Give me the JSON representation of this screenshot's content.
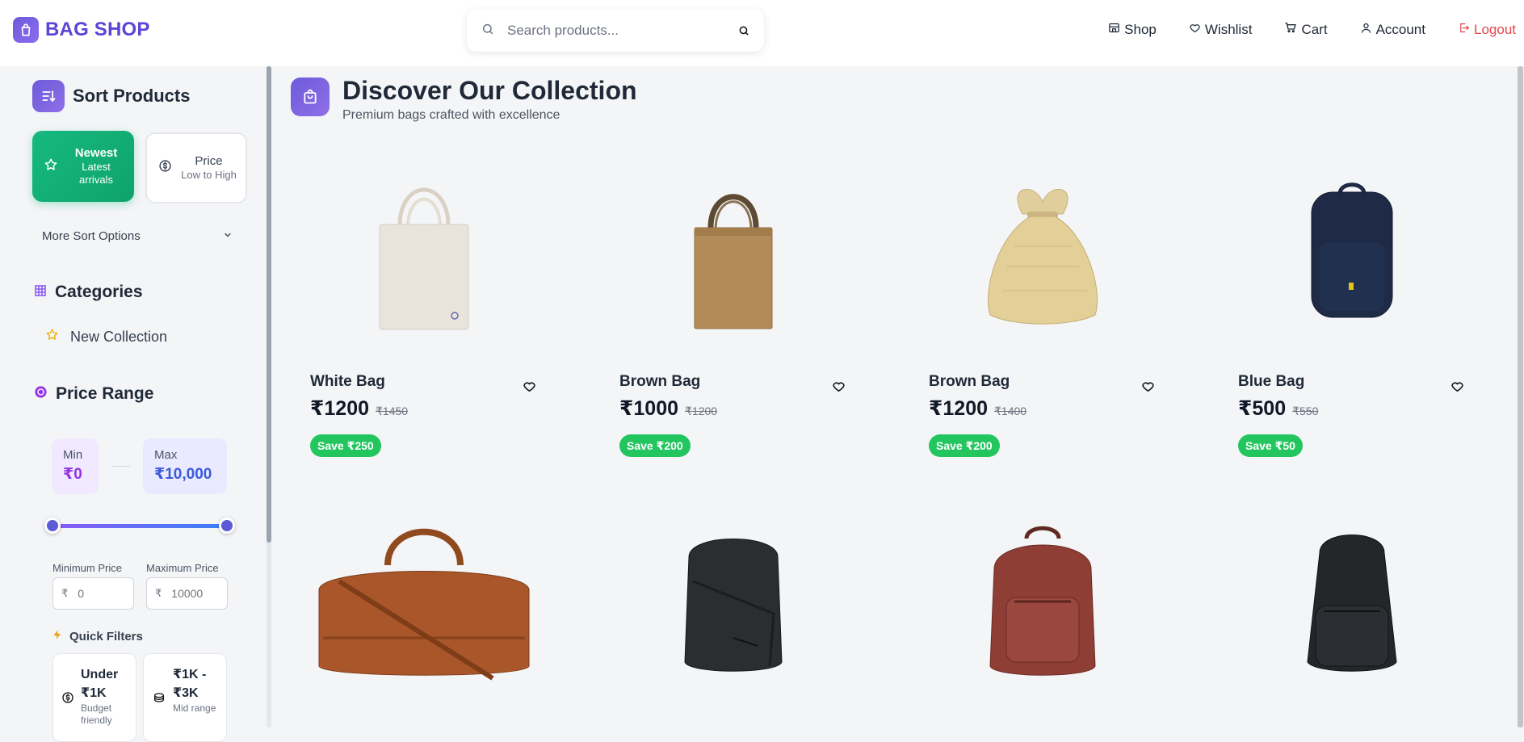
{
  "header": {
    "brand": "BAG SHOP",
    "search_placeholder": "Search products...",
    "nav": [
      {
        "label": "Shop",
        "icon": "store-icon"
      },
      {
        "label": "Wishlist",
        "icon": "heart-icon"
      },
      {
        "label": "Cart",
        "icon": "cart-icon"
      },
      {
        "label": "Account",
        "icon": "user-icon"
      },
      {
        "label": "Logout",
        "icon": "logout-icon"
      }
    ]
  },
  "sidebar": {
    "sort": {
      "title": "Sort Products",
      "newest": {
        "title": "Newest",
        "subtitle": "Latest arrivals"
      },
      "price": {
        "title": "Price",
        "subtitle": "Low to High"
      },
      "more": "More Sort Options"
    },
    "categories": {
      "title": "Categories",
      "items": [
        "New Collection"
      ]
    },
    "price_range": {
      "title": "Price Range",
      "min_label": "Min",
      "min_value": "₹0",
      "max_label": "Max",
      "max_value": "₹10,000",
      "min_field_label": "Minimum Price",
      "max_field_label": "Maximum Price",
      "currency": "₹",
      "min_placeholder": "0",
      "max_placeholder": "10000",
      "quick_title": "Quick Filters",
      "quick": [
        {
          "title": "Under ₹1K",
          "subtitle": "Budget friendly"
        },
        {
          "title": "₹1K - ₹3K",
          "subtitle": "Mid range"
        }
      ]
    }
  },
  "main": {
    "title": "Discover Our Collection",
    "subtitle": "Premium bags crafted with excellence",
    "products": [
      {
        "name": "White Bag",
        "price": "₹1200",
        "old_price": "₹1450",
        "save": "Save ₹250"
      },
      {
        "name": "Brown Bag",
        "price": "₹1000",
        "old_price": "₹1200",
        "save": "Save ₹200"
      },
      {
        "name": "Brown Bag",
        "price": "₹1200",
        "old_price": "₹1400",
        "save": "Save ₹200"
      },
      {
        "name": "Blue Bag",
        "price": "₹500",
        "old_price": "₹550",
        "save": "Save ₹50"
      }
    ]
  },
  "colors": {
    "brand": "#5b45d6",
    "accent_green": "#22c55e",
    "logout": "#e5484d"
  }
}
